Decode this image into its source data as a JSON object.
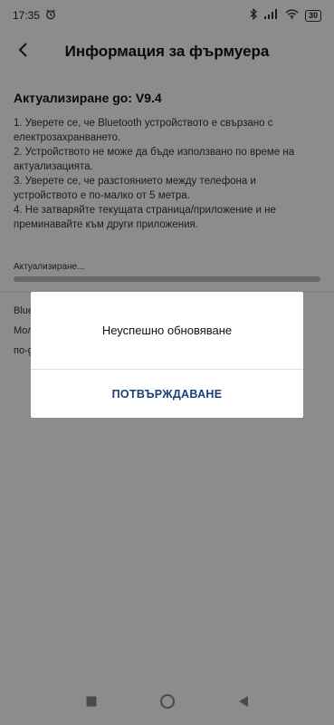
{
  "status_bar": {
    "time": "17:35",
    "battery": "30",
    "icons": [
      "alarm-icon",
      "bluetooth-icon",
      "signal-icon",
      "wifi-icon",
      "battery-icon"
    ]
  },
  "header": {
    "title": "Информация за фърмуера",
    "back_icon": "chevron-left-icon"
  },
  "content": {
    "update_title": "Актуализиране go: V9.4",
    "instructions": [
      "1. Уверете се, че Bluetooth устройството е свързано с електрозахранването.",
      " 2. Устройството не може да бъде използвано по време на актуализацията.",
      " 3. Уверете се, че разстоянието между телефона и устройството е по-малко от 5 метра.",
      "4. Не затваряйте текущата страница/приложение и не преминавайте към други приложения."
    ],
    "progress_label": "Актуализиране...",
    "progress_fraction": 1.0,
    "bt_lines": [
      "Blue",
      "Мол",
      "по-g"
    ]
  },
  "dialog": {
    "message": "Неуспешно обновяване",
    "confirm_label": "ПОТВЪРЖДАВАНЕ"
  },
  "nav_bar": {
    "icons": [
      "square-icon",
      "circle-icon",
      "triangle-back-icon"
    ]
  },
  "colors": {
    "dialog_button": "#1b3f7a",
    "overlay": "rgba(0,0,0,0.45)"
  }
}
